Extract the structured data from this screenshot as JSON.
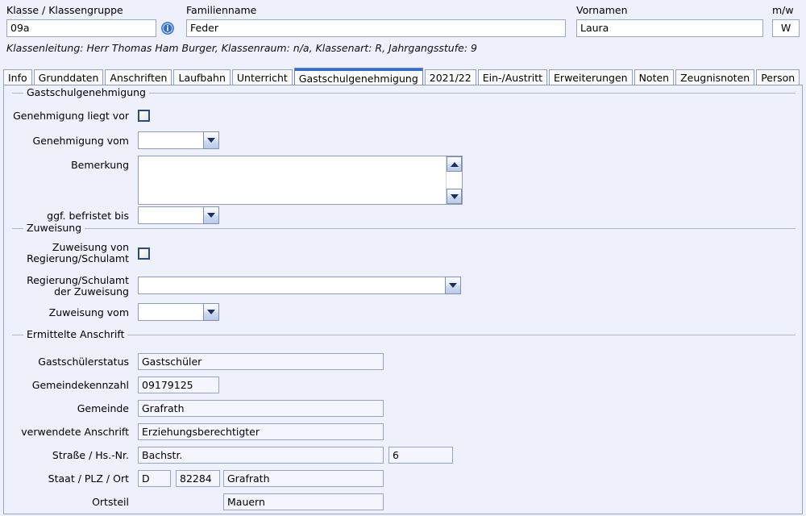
{
  "header": {
    "klasse_label": "Klasse / Klassengruppe",
    "klasse_value": "09a",
    "info_icon": "info-icon",
    "familienname_label": "Familienname",
    "familienname_value": "Feder",
    "vornamen_label": "Vornamen",
    "vornamen_value": "Laura",
    "mw_label": "m/w",
    "mw_value": "W",
    "klassenleitung": "Klassenleitung: Herr Thomas Ham Burger, Klassenraum: n/a, Klassenart: R, Jahrgangsstufe: 9"
  },
  "tabs": [
    {
      "label": "Info",
      "active": false
    },
    {
      "label": "Grunddaten",
      "active": false
    },
    {
      "label": "Anschriften",
      "active": false
    },
    {
      "label": "Laufbahn",
      "active": false
    },
    {
      "label": "Unterricht",
      "active": false
    },
    {
      "label": "Gastschulgenehmigung",
      "active": true
    },
    {
      "label": "2021/22",
      "active": false
    },
    {
      "label": "Ein-/Austritt",
      "active": false
    },
    {
      "label": "Erweiterungen",
      "active": false
    },
    {
      "label": "Noten",
      "active": false
    },
    {
      "label": "Zeugnisnoten",
      "active": false
    },
    {
      "label": "Person",
      "active": false
    }
  ],
  "groups": {
    "gastschulgenehmigung": {
      "title": "Gastschulgenehmigung",
      "genehmigung_liegt_vor_label": "Genehmigung liegt vor",
      "genehmigung_liegt_vor_checked": false,
      "genehmigung_vom_label": "Genehmigung vom",
      "genehmigung_vom_value": "",
      "bemerkung_label": "Bemerkung",
      "bemerkung_value": "",
      "befristet_label": "ggf. befristet bis",
      "befristet_value": ""
    },
    "zuweisung": {
      "title": "Zuweisung",
      "zuweisung_von_label": "Zuweisung von Regierung/Schulamt",
      "zuweisung_von_checked": false,
      "regierung_label": "Regierung/Schulamt der Zuweisung",
      "regierung_value": "",
      "zuweisung_vom_label": "Zuweisung vom",
      "zuweisung_vom_value": ""
    },
    "ermittelte_anschrift": {
      "title": "Ermittelte Anschrift",
      "gastschuelerstatus_label": "Gastschülerstatus",
      "gastschuelerstatus_value": "Gastschüler",
      "gemeindekennzahl_label": "Gemeindekennzahl",
      "gemeindekennzahl_value": "09179125",
      "gemeinde_label": "Gemeinde",
      "gemeinde_value": "Grafrath",
      "verwendete_anschrift_label": "verwendete Anschrift",
      "verwendete_anschrift_value": "Erziehungsberechtigter",
      "strasse_label": "Straße / Hs.-Nr.",
      "strasse_value": "Bachstr.",
      "hausnummer_value": "6",
      "staat_plz_ort_label": "Staat / PLZ / Ort",
      "staat_value": "D",
      "plz_value": "82284",
      "ort_value": "Grafrath",
      "ortsteil_label": "Ortsteil",
      "ortsteil_value": "Mauern"
    }
  },
  "colors": {
    "background": "#eef0fb",
    "field_border": "#97a5c2",
    "active_tab_accent": "#2a6ddb",
    "info_icon": "#3a72c8"
  }
}
